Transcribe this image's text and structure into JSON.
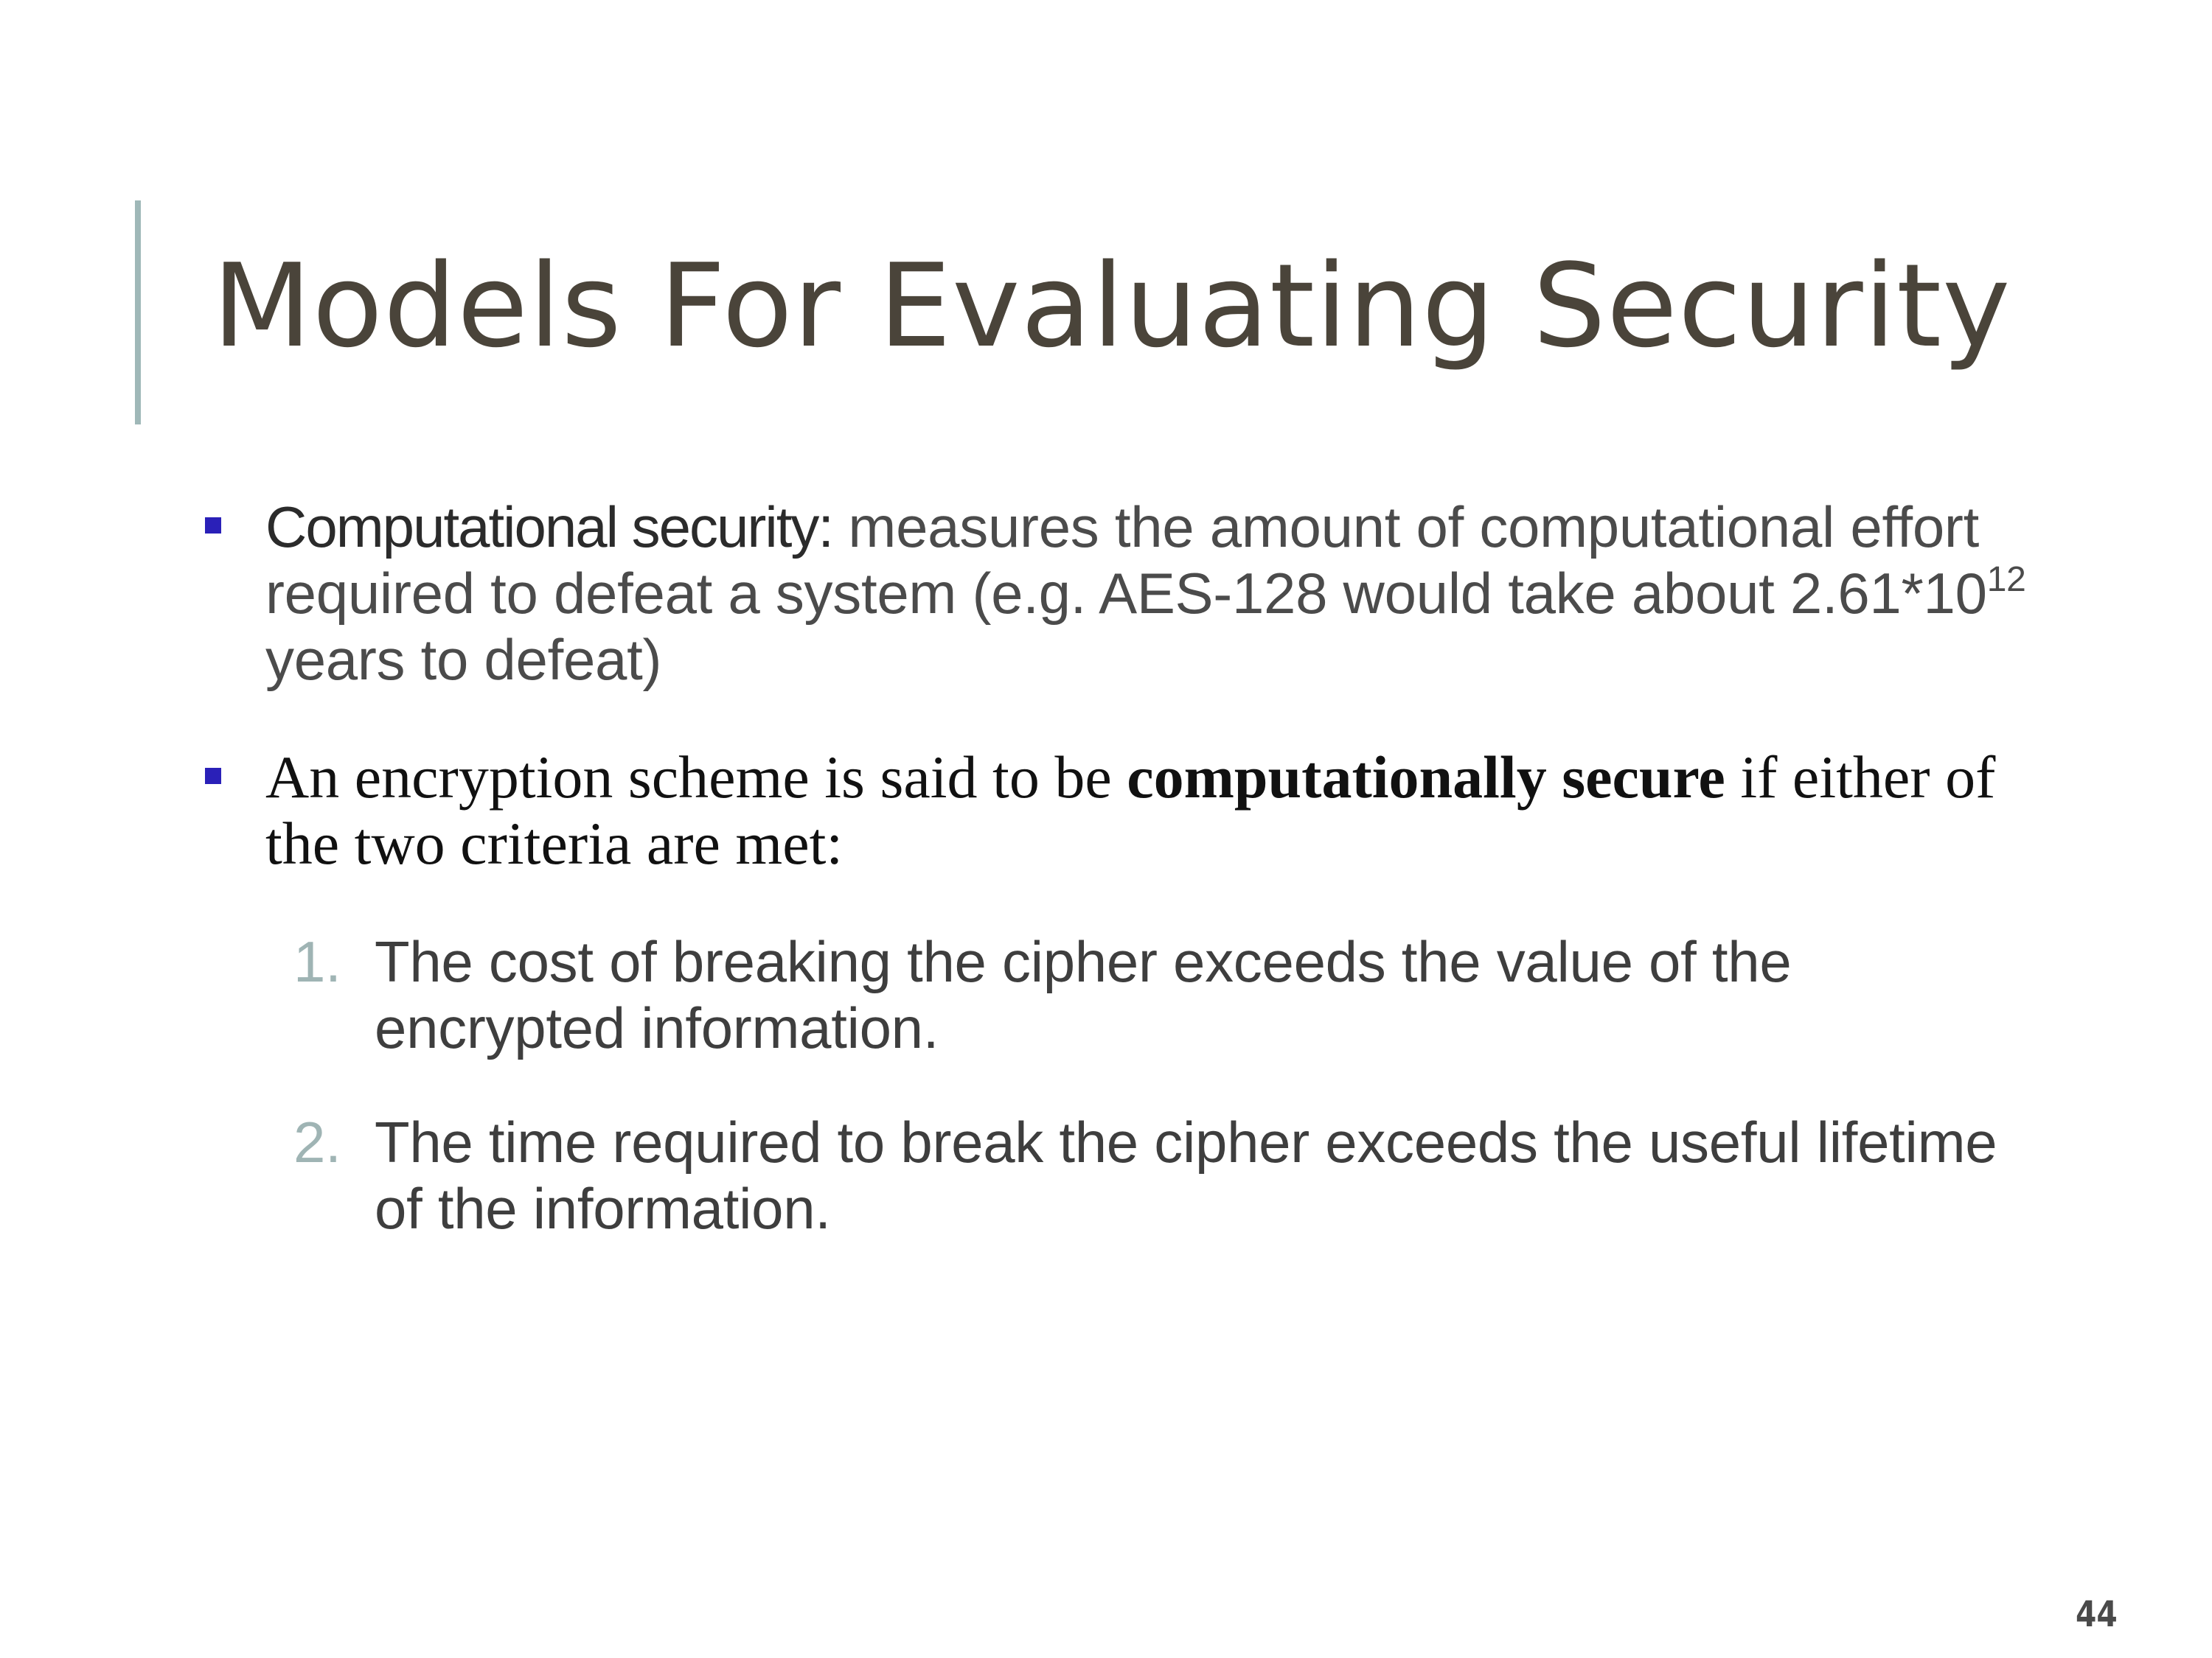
{
  "slide": {
    "title": "Models For Evaluating Security",
    "page_number": "44",
    "bullets": [
      {
        "lead": "Computational security:",
        "text_before_sup": " measures the amount of computational effort required to defeat a system (e.g. AES-128 would take about 2.61*10",
        "sup": "12",
        "text_after_sup": " years to defeat)"
      },
      {
        "text_before_bold": "An encryption scheme is said to be ",
        "bold": "computationally secure",
        "text_after_bold": " if either of the two criteria are met:"
      }
    ],
    "criteria": [
      {
        "label": "1.",
        "text": "The cost of breaking the cipher exceeds the value of the encrypted information."
      },
      {
        "label": "2.",
        "text": "The time required to break the cipher exceeds the useful lifetime of the information."
      }
    ]
  },
  "colors": {
    "title": "#4a443a",
    "accent_bar": "#9fb8b8",
    "bullet_marker": "#2a20b8",
    "number_label": "#9fb4b4"
  }
}
